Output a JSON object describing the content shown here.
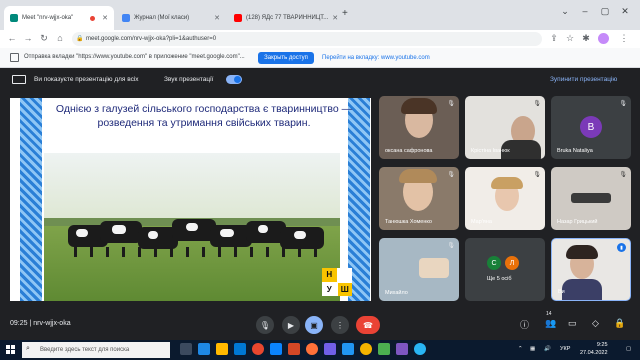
{
  "browser": {
    "tabs": [
      {
        "title": "Meet \"nrv-wjjx-oka\"",
        "favicon_color": "#00897b",
        "recording_dot": "#ea4335"
      },
      {
        "title": "Журнал (Мої класи)",
        "favicon_color": "#4285f4"
      },
      {
        "title": "(128) ЯДс 77 ТВАРИННИЦТ...",
        "favicon_color": "#ff0000"
      }
    ],
    "new_tab": "+",
    "url": "meet.google.com/nrv-wjjx-oka?pli=1&authuser=0",
    "infobar": {
      "text": "Отправка вкладки \"https://www.youtube.com\" в приложение \"meet.google.com\"...",
      "share_button": "Закрыть доступ",
      "goto_link": "Перейти на вкладку: www.youtube.com"
    }
  },
  "meet": {
    "presenting_text": "Ви показуєте презентацію для всіх",
    "sound_label": "Звук презентації",
    "stop_label": "Зупинити презентацію",
    "meeting_time": "09:25",
    "meeting_code": "nrv-wjjx-oka",
    "people_badge": "14",
    "participants": [
      {
        "name": "оксана сафронова"
      },
      {
        "name": "Крістіна Іванюк"
      },
      {
        "name": "Bruka Nataliya",
        "initial": "B",
        "avatar_color": "#7b3ab8"
      },
      {
        "name": "Танюшка Хоменко"
      },
      {
        "name": "Мар'яна"
      },
      {
        "name": "Назар Грицький"
      },
      {
        "name": "Михайло"
      },
      {
        "name": "Ще 5 осіб",
        "initials": [
          "С",
          "Л"
        ],
        "colors": [
          "#188038",
          "#e8710a"
        ]
      },
      {
        "name": "Ви"
      }
    ]
  },
  "slide": {
    "title": "Однією з галузей сільського господарства є тваринництво — розведення та утримання свійських тварин.",
    "logo_letters": [
      "Н",
      "",
      "У",
      "Ш"
    ]
  },
  "taskbar": {
    "search_placeholder": "Введите здесь текст для поиска",
    "tray_lang": "УКР",
    "time": "9:25",
    "date": "27.04.2022"
  }
}
